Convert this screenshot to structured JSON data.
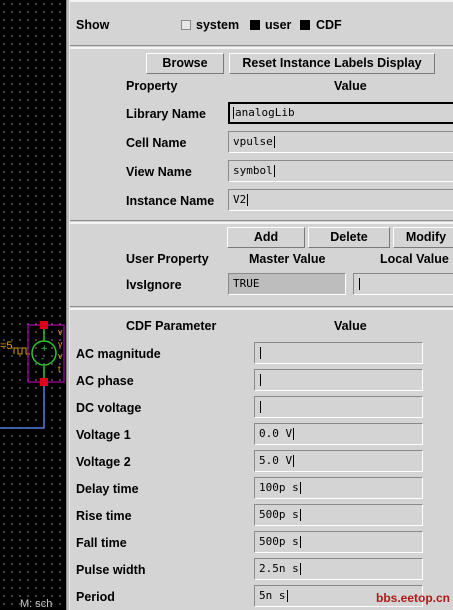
{
  "canvas": {
    "label_left": "=5",
    "label_bottom": "M: sch",
    "symbol_pins": [
      "v",
      "v",
      "v",
      "t"
    ]
  },
  "show": {
    "label": "Show",
    "options": [
      {
        "label": "system",
        "checked": false
      },
      {
        "label": "user",
        "checked": true
      },
      {
        "label": "CDF",
        "checked": true
      }
    ]
  },
  "instance": {
    "browse_label": "Browse",
    "reset_label": "Reset Instance Labels Display",
    "col_property": "Property",
    "col_value": "Value",
    "rows": [
      {
        "label": "Library Name",
        "value": "analogLib"
      },
      {
        "label": "Cell Name",
        "value": "vpulse"
      },
      {
        "label": "View Name",
        "value": "symbol"
      },
      {
        "label": "Instance Name",
        "value": "V2"
      }
    ]
  },
  "user_props": {
    "add_label": "Add",
    "delete_label": "Delete",
    "modify_label": "Modify",
    "col_user_property": "User Property",
    "col_master_value": "Master Value",
    "col_local_value": "Local Value",
    "rows": [
      {
        "label": "lvsIgnore",
        "master": "TRUE",
        "local": ""
      }
    ]
  },
  "cdf": {
    "col_param": "CDF Parameter",
    "col_value": "Value",
    "rows": [
      {
        "label": "AC magnitude",
        "value": ""
      },
      {
        "label": "AC phase",
        "value": ""
      },
      {
        "label": "DC voltage",
        "value": ""
      },
      {
        "label": "Voltage 1",
        "value": "0.0 V"
      },
      {
        "label": "Voltage 2",
        "value": "5.0 V"
      },
      {
        "label": "Delay time",
        "value": "100p s"
      },
      {
        "label": "Rise time",
        "value": "500p s"
      },
      {
        "label": "Fall time",
        "value": "500p s"
      },
      {
        "label": "Pulse width",
        "value": "2.5n s"
      },
      {
        "label": "Period",
        "value": "5n s"
      }
    ]
  },
  "watermark": "bbs.eetop.cn",
  "colors": {
    "canvas_bg": "#000000",
    "wire": "#4a7fd8",
    "symbol": "#d000d0",
    "pin": "#e0001a",
    "source": "#2ec42e",
    "label": "#e0a000"
  }
}
